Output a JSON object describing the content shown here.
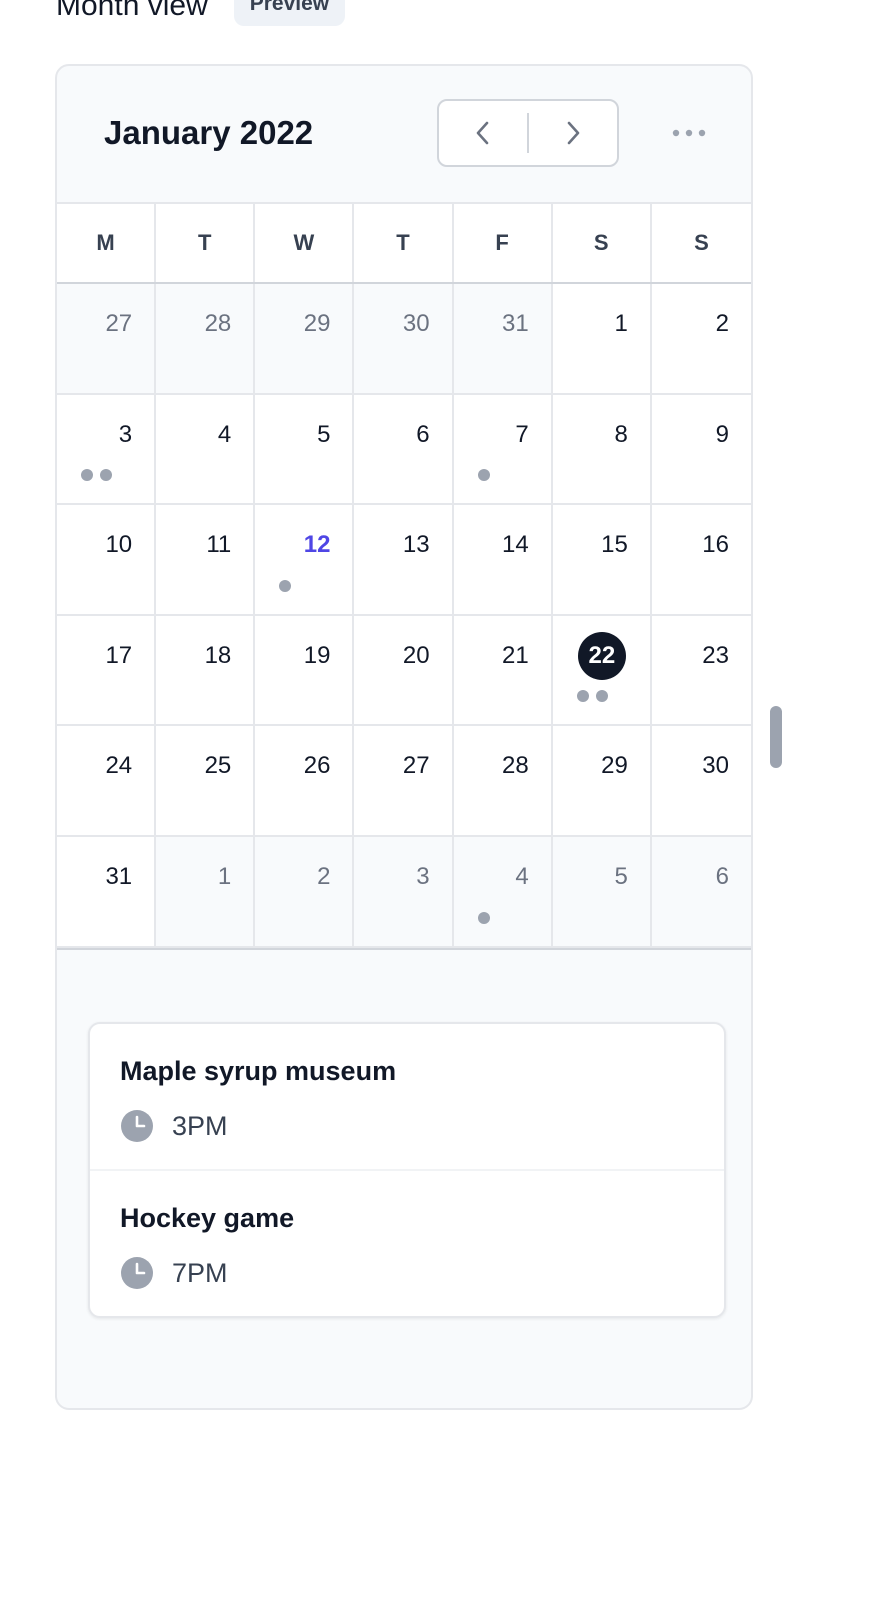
{
  "header": {
    "title": "Month view",
    "badge": "Preview"
  },
  "calendar": {
    "month_label": "January 2022",
    "prev_icon": "chevron-left-icon",
    "next_icon": "chevron-right-icon",
    "more_icon": "ellipsis-horizontal-icon",
    "weekdays": [
      "M",
      "T",
      "W",
      "T",
      "F",
      "S",
      "S"
    ],
    "days": [
      {
        "date": "27",
        "current": false,
        "events": 0
      },
      {
        "date": "28",
        "current": false,
        "events": 0
      },
      {
        "date": "29",
        "current": false,
        "events": 0
      },
      {
        "date": "30",
        "current": false,
        "events": 0
      },
      {
        "date": "31",
        "current": false,
        "events": 0
      },
      {
        "date": "1",
        "current": true,
        "events": 0
      },
      {
        "date": "2",
        "current": true,
        "events": 0
      },
      {
        "date": "3",
        "current": true,
        "events": 2
      },
      {
        "date": "4",
        "current": true,
        "events": 0
      },
      {
        "date": "5",
        "current": true,
        "events": 0
      },
      {
        "date": "6",
        "current": true,
        "events": 0
      },
      {
        "date": "7",
        "current": true,
        "events": 1
      },
      {
        "date": "8",
        "current": true,
        "events": 0
      },
      {
        "date": "9",
        "current": true,
        "events": 0
      },
      {
        "date": "10",
        "current": true,
        "events": 0
      },
      {
        "date": "11",
        "current": true,
        "events": 0
      },
      {
        "date": "12",
        "current": true,
        "events": 1,
        "today": true
      },
      {
        "date": "13",
        "current": true,
        "events": 0
      },
      {
        "date": "14",
        "current": true,
        "events": 0
      },
      {
        "date": "15",
        "current": true,
        "events": 0
      },
      {
        "date": "16",
        "current": true,
        "events": 0
      },
      {
        "date": "17",
        "current": true,
        "events": 0
      },
      {
        "date": "18",
        "current": true,
        "events": 0
      },
      {
        "date": "19",
        "current": true,
        "events": 0
      },
      {
        "date": "20",
        "current": true,
        "events": 0
      },
      {
        "date": "21",
        "current": true,
        "events": 0
      },
      {
        "date": "22",
        "current": true,
        "events": 2,
        "selected": true
      },
      {
        "date": "23",
        "current": true,
        "events": 0
      },
      {
        "date": "24",
        "current": true,
        "events": 0
      },
      {
        "date": "25",
        "current": true,
        "events": 0
      },
      {
        "date": "26",
        "current": true,
        "events": 0
      },
      {
        "date": "27",
        "current": true,
        "events": 0
      },
      {
        "date": "28",
        "current": true,
        "events": 0
      },
      {
        "date": "29",
        "current": true,
        "events": 0
      },
      {
        "date": "30",
        "current": true,
        "events": 0
      },
      {
        "date": "31",
        "current": true,
        "events": 0
      },
      {
        "date": "1",
        "current": false,
        "events": 0
      },
      {
        "date": "2",
        "current": false,
        "events": 0
      },
      {
        "date": "3",
        "current": false,
        "events": 0
      },
      {
        "date": "4",
        "current": false,
        "events": 1
      },
      {
        "date": "5",
        "current": false,
        "events": 0
      },
      {
        "date": "6",
        "current": false,
        "events": 0
      }
    ]
  },
  "events": [
    {
      "name": "Maple syrup museum",
      "time": "3PM",
      "icon": "clock-icon"
    },
    {
      "name": "Hockey game",
      "time": "7PM",
      "icon": "clock-icon"
    }
  ],
  "colors": {
    "accent": "#4f46e5",
    "selected": "#111827",
    "dot": "#9ca3af"
  }
}
